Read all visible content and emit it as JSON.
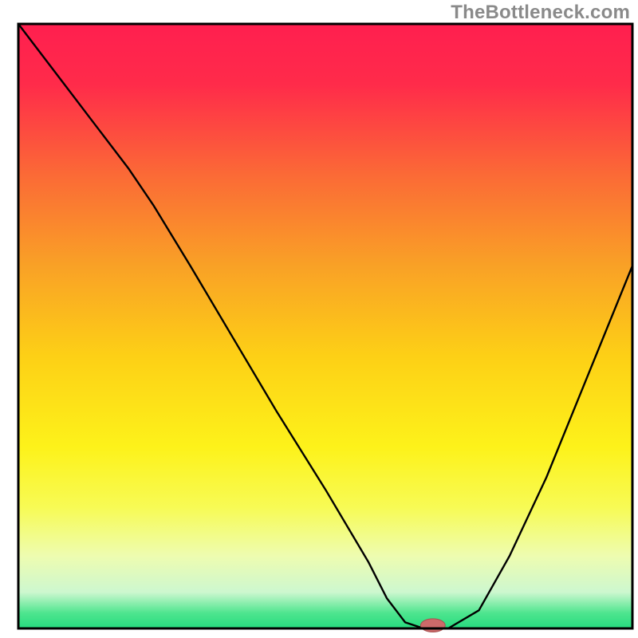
{
  "watermark": {
    "text": "TheBottleneck.com"
  },
  "chart_data": {
    "type": "line",
    "title": "",
    "xlabel": "",
    "ylabel": "",
    "xlim": [
      0,
      100
    ],
    "ylim": [
      0,
      100
    ],
    "grid": false,
    "legend": false,
    "background": {
      "kind": "vertical-gradient",
      "stops": [
        {
          "offset": 0.0,
          "color": "#ff1f4f"
        },
        {
          "offset": 0.1,
          "color": "#ff2b4a"
        },
        {
          "offset": 0.25,
          "color": "#fb6a36"
        },
        {
          "offset": 0.4,
          "color": "#f9a126"
        },
        {
          "offset": 0.55,
          "color": "#fdd016"
        },
        {
          "offset": 0.7,
          "color": "#fdf21a"
        },
        {
          "offset": 0.8,
          "color": "#f7fb55"
        },
        {
          "offset": 0.88,
          "color": "#eefcb0"
        },
        {
          "offset": 0.94,
          "color": "#cdf7cf"
        },
        {
          "offset": 0.975,
          "color": "#4de58e"
        },
        {
          "offset": 1.0,
          "color": "#26db7f"
        }
      ]
    },
    "series": [
      {
        "name": "bottleneck-curve",
        "color": "#000000",
        "stroke_width": 2.4,
        "x": [
          0,
          6,
          12,
          18,
          22,
          28,
          35,
          42,
          50,
          57,
          60,
          63,
          66,
          70,
          75,
          80,
          86,
          92,
          96,
          100
        ],
        "y": [
          100,
          92,
          84,
          76,
          70,
          60,
          48,
          36,
          23,
          11,
          5,
          1,
          0,
          0,
          3,
          12,
          25,
          40,
          50,
          60
        ]
      }
    ],
    "marker": {
      "name": "optimal-point",
      "x": 67.5,
      "y": 0.5,
      "rx": 2.0,
      "ry": 1.1,
      "fill": "#cc6a6a",
      "stroke": "#a84f4f"
    },
    "frame": {
      "stroke": "#000000",
      "width": 3
    }
  }
}
